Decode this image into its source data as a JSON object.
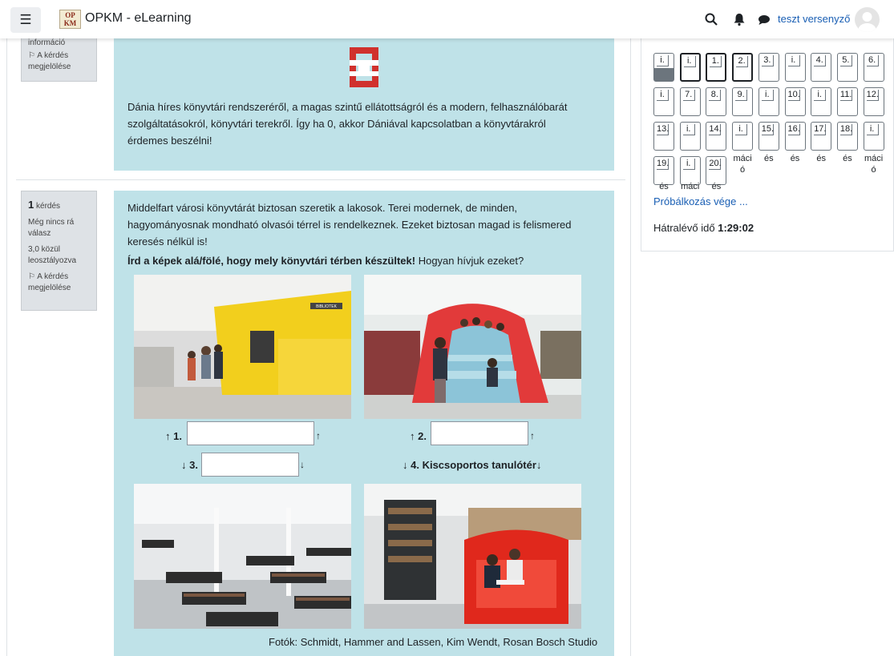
{
  "header": {
    "site_title": "OPKM - eLearning",
    "logo_text": "OP KM",
    "username": "teszt versenyző",
    "icons": [
      "menu-icon",
      "search-icon",
      "bell-icon",
      "chat-icon",
      "avatar"
    ]
  },
  "prev_info": {
    "label_top": "információ",
    "flag": "⚐ A kérdés megjelölése"
  },
  "prev_question": {
    "text": "Dánia híres könyvtári rendszeréről, a magas szintű ellátottságról és a modern, felhasználóbarát szolgáltatásokról, könyvtári terekről. Így ha 0, akkor Dániával kapcsolatban a könyvtárakról érdemes beszélni!"
  },
  "q_info": {
    "number": "1",
    "number_label": "kérdés",
    "status": "Még nincs rá válasz",
    "points": "3,0 közül leosztályozva",
    "flag": "⚐ A kérdés megjelölése"
  },
  "question": {
    "intro": "Middelfart városi könyvtárát biztosan szeretik a lakosok. Terei modernek, de minden, hagyományosnak mondható olvasói térrel is rendelkeznek. Ezeket biztosan magad is felismered keresés nélkül is!",
    "instruction_bold": "Írd a képek alá/fölé, hogy mely könyvtári térben készültek!",
    "instruction_rest": " Hogyan hívjuk ezeket?",
    "label1": "1.",
    "label2": "2.",
    "label3": "3.",
    "label4": "4. Kiscsoportos tanulótér",
    "up_arrow": "↑",
    "down_arrow": "↓",
    "answers": [
      "",
      "",
      ""
    ],
    "photo_sign": "BIBLIOTEK",
    "credit": "Fotók: Schmidt, Hammer and Lassen, Kim Wendt, Rosan Bosch Studio"
  },
  "nav": {
    "rows": [
      [
        "i.",
        "i.",
        "1.",
        "2.",
        "3.",
        "i.",
        "4.",
        "5.",
        "6."
      ],
      [
        "i.",
        "7.",
        "8.",
        "9.",
        "i.",
        "10.",
        "i.",
        "11.",
        "12."
      ],
      [
        "13.",
        "i.",
        "14.",
        "i.",
        "15.",
        "16.",
        "17.",
        "18.",
        "i."
      ],
      [
        "19.",
        "i.",
        "20."
      ]
    ],
    "fragments_row4": [
      "máci ó",
      "és",
      "és",
      "és",
      "és",
      "máci ó"
    ],
    "fragments_row5": [
      "és",
      "máci",
      "és"
    ],
    "finish_link": "Próbálkozás vége ...",
    "timer_label": "Hátralévő idő",
    "timer_value": "1:29:02"
  }
}
